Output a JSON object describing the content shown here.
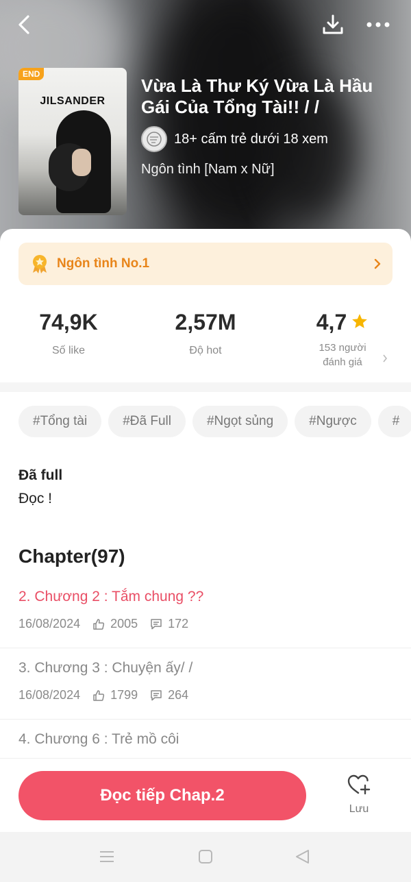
{
  "header": {
    "end_badge": "END",
    "cover_brand": "JILSANDER",
    "title": "Vừa Là Thư Ký Vừa Là Hầu Gái Của Tổng Tài!! / /",
    "age_rating": "18+ cấm trẻ dưới 18 xem",
    "genre": "Ngôn tình [Nam x Nữ]"
  },
  "rank_banner": {
    "label": "Ngôn tình No.1"
  },
  "stats": {
    "likes": {
      "value": "74,9K",
      "label": "Số like"
    },
    "hot": {
      "value": "2,57M",
      "label": "Độ hot"
    },
    "rating": {
      "value": "4,7",
      "label_line1": "153 người",
      "label_line2": "đánh giá"
    }
  },
  "tags": [
    "#Tổng tài",
    "#Đã Full",
    "#Ngọt sủng",
    "#Ngược",
    "#"
  ],
  "description": {
    "title": "Đã full",
    "body": "Đọc !"
  },
  "chapters_heading": "Chapter(97)",
  "chapters": [
    {
      "title": "2. Chương 2 : Tắm chung ??",
      "date": "16/08/2024",
      "likes": "2005",
      "comments": "172",
      "active": true
    },
    {
      "title": "3. Chương 3 : Chuyện ấy/ /",
      "date": "16/08/2024",
      "likes": "1799",
      "comments": "264",
      "active": false
    },
    {
      "title": "4. Chương 6 : Trẻ mồ côi",
      "date": "",
      "likes": "",
      "comments": "",
      "active": false
    }
  ],
  "actions": {
    "read_button": "Đọc tiếp Chap.2",
    "save_label": "Lưu"
  },
  "colors": {
    "accent": "#f25368",
    "rank_text": "#e8851a",
    "star": "#f7b500"
  }
}
